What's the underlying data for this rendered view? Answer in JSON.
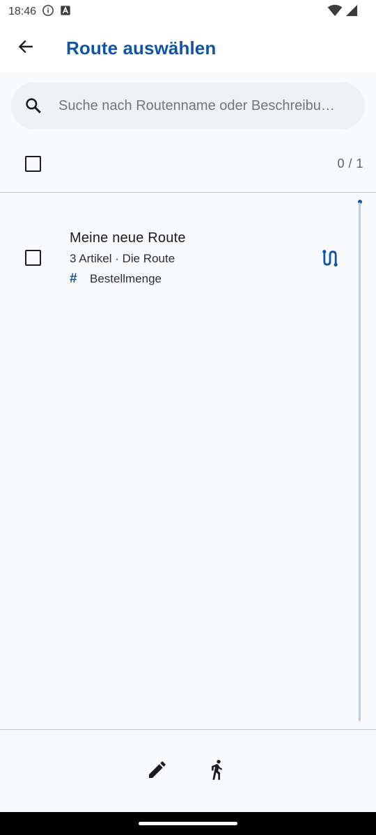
{
  "status_bar": {
    "time": "18:46",
    "icons": [
      "info-icon",
      "a-box-icon",
      "wifi-icon",
      "cellular-icon"
    ]
  },
  "app_bar": {
    "title": "Route auswählen",
    "back_icon": "arrow-back-icon"
  },
  "search": {
    "placeholder": "Suche nach Routenname oder Beschreibu…",
    "value": ""
  },
  "selection": {
    "counter": "0 / 1",
    "select_all_checked": false
  },
  "routes": [
    {
      "name": "Meine neue Route",
      "subtitle": "3 Artikel · Die Route",
      "tag_symbol": "#",
      "tag_label": "Bestellmenge",
      "checked": false,
      "icon": "route-icon"
    }
  ],
  "bottom_actions": {
    "edit_icon": "edit-pencil-icon",
    "run_icon": "run-icon"
  },
  "colors": {
    "accent": "#0d55a8",
    "background": "#f8fafc",
    "search_bg": "#eef2f5",
    "scroll_track": "#b9cfea"
  }
}
